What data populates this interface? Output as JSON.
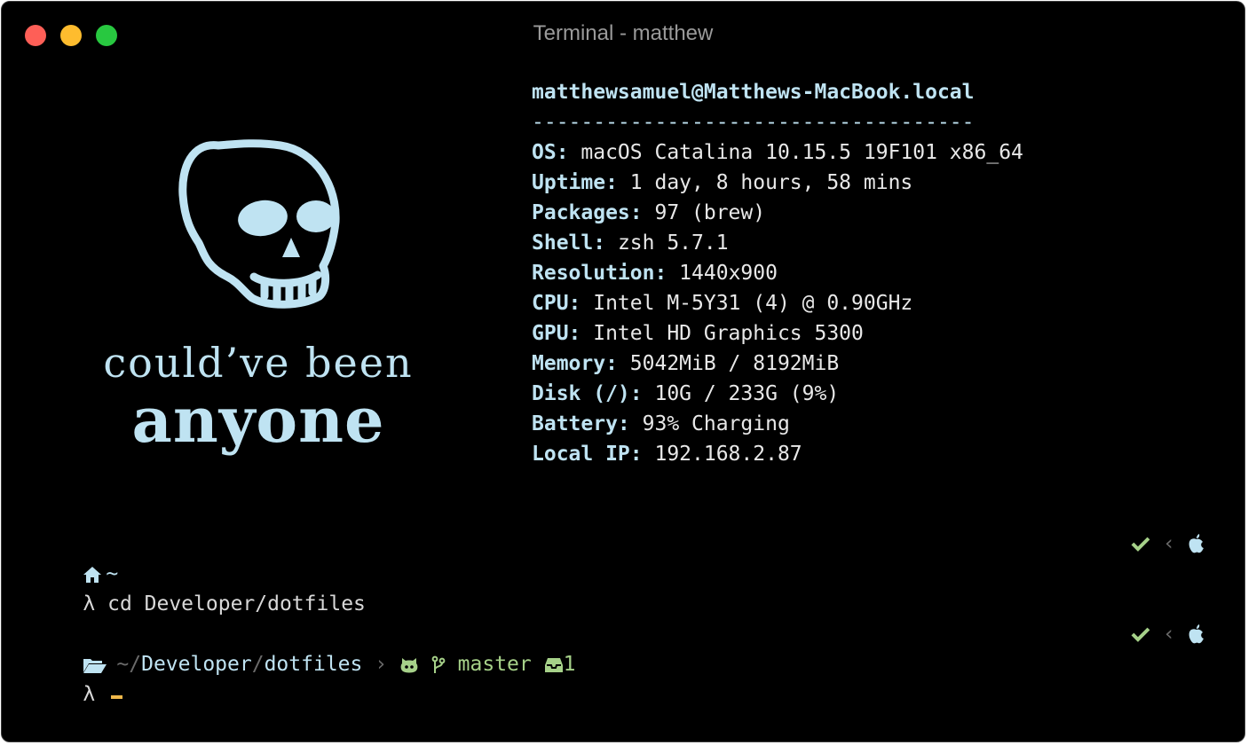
{
  "window": {
    "title": "Terminal - matthew"
  },
  "art": {
    "line1": "could’ve been",
    "line2": "anyone"
  },
  "sysinfo": {
    "host": "matthewsamuel@Matthews-MacBook.local",
    "separator": "------------------------------------",
    "rows": [
      {
        "key": "OS:",
        "value": " macOS Catalina 10.15.5 19F101 x86_64"
      },
      {
        "key": "Uptime:",
        "value": " 1 day, 8 hours, 58 mins"
      },
      {
        "key": "Packages:",
        "value": " 97 (brew)"
      },
      {
        "key": "Shell:",
        "value": " zsh 5.7.1"
      },
      {
        "key": "Resolution:",
        "value": " 1440x900"
      },
      {
        "key": "CPU:",
        "value": " Intel M-5Y31 (4) @ 0.90GHz"
      },
      {
        "key": "GPU:",
        "value": " Intel HD Graphics 5300"
      },
      {
        "key": "Memory:",
        "value": " 5042MiB / 8192MiB"
      },
      {
        "key": "Disk (/):",
        "value": " 10G / 233G (9%)"
      },
      {
        "key": "Battery:",
        "value": " 93% Charging"
      },
      {
        "key": "Local IP:",
        "value": " 192.168.2.87"
      }
    ]
  },
  "prompt1": {
    "path": "~",
    "lambda": "λ",
    "command": " cd Developer/dotfiles"
  },
  "prompt2": {
    "path_tilde": "~/",
    "path_dir1": "Developer",
    "path_slash": "/",
    "path_dir2": "dotfiles",
    "chevron": "›",
    "branch": "master",
    "stash_count": "1",
    "lambda": "λ"
  },
  "status": {
    "chevron_left": "‹"
  },
  "icons": {
    "home": "home-icon",
    "folder": "folder-open-icon",
    "github": "github-icon",
    "branch": "git-branch-icon",
    "inbox": "inbox-icon",
    "check": "check-icon",
    "apple": "apple-icon"
  },
  "colors": {
    "accent_blue": "#bfe3f2",
    "git_green": "#a6d189",
    "cursor": "#f0b84a"
  }
}
